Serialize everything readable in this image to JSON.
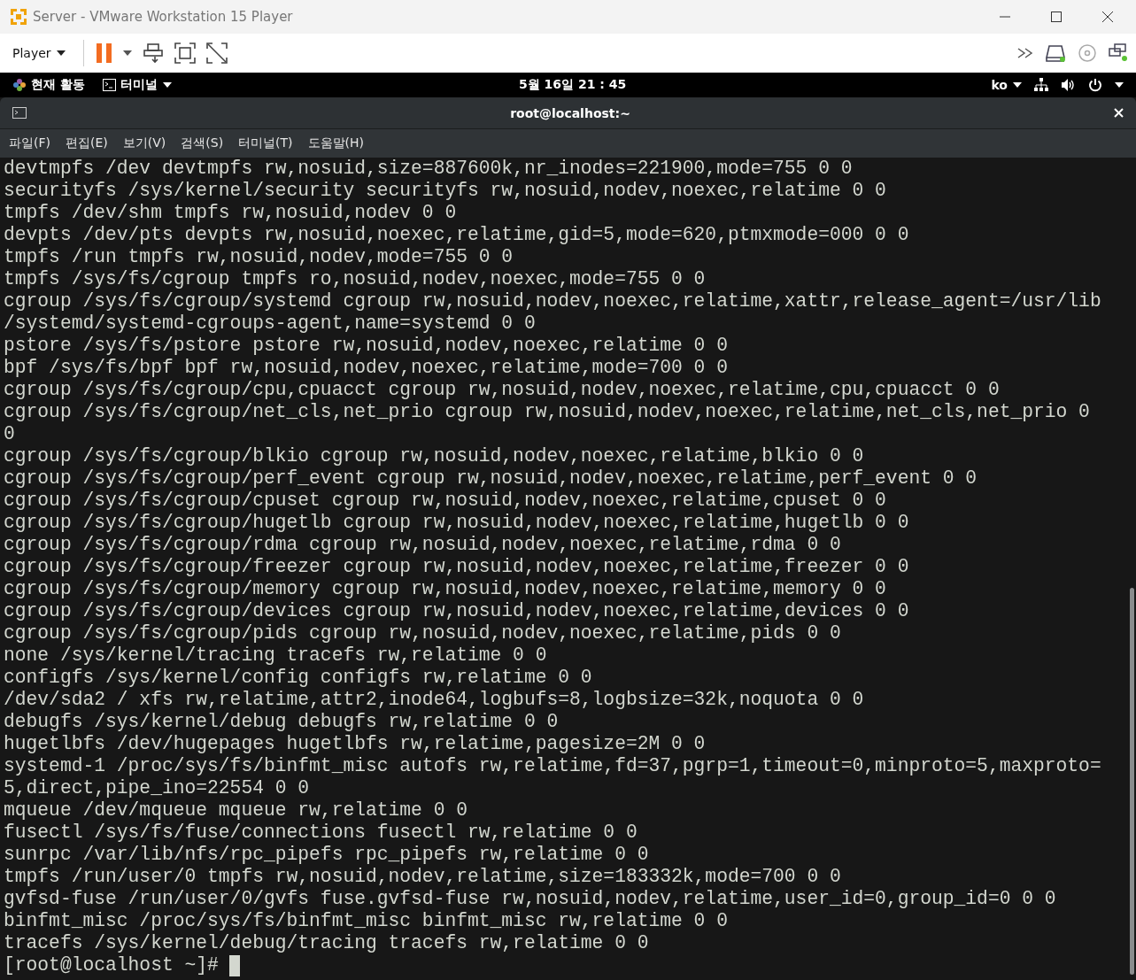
{
  "window": {
    "title": "Server - VMware Workstation 15 Player"
  },
  "toolbar": {
    "player_menu": "Player"
  },
  "top_bar": {
    "activities": "현재 활동",
    "app_menu": "터미널",
    "clock": "5월 16일  21 : 45",
    "input_method": "ko"
  },
  "terminal": {
    "title": "root@localhost:~",
    "menu": [
      "파일(F)",
      "편집(E)",
      "보기(V)",
      "검색(S)",
      "터미널(T)",
      "도움말(H)"
    ],
    "lines": [
      "devtmpfs /dev devtmpfs rw,nosuid,size=887600k,nr_inodes=221900,mode=755 0 0",
      "securityfs /sys/kernel/security securityfs rw,nosuid,nodev,noexec,relatime 0 0",
      "tmpfs /dev/shm tmpfs rw,nosuid,nodev 0 0",
      "devpts /dev/pts devpts rw,nosuid,noexec,relatime,gid=5,mode=620,ptmxmode=000 0 0",
      "tmpfs /run tmpfs rw,nosuid,nodev,mode=755 0 0",
      "tmpfs /sys/fs/cgroup tmpfs ro,nosuid,nodev,noexec,mode=755 0 0",
      "cgroup /sys/fs/cgroup/systemd cgroup rw,nosuid,nodev,noexec,relatime,xattr,release_agent=/usr/lib",
      "/systemd/systemd-cgroups-agent,name=systemd 0 0",
      "pstore /sys/fs/pstore pstore rw,nosuid,nodev,noexec,relatime 0 0",
      "bpf /sys/fs/bpf bpf rw,nosuid,nodev,noexec,relatime,mode=700 0 0",
      "cgroup /sys/fs/cgroup/cpu,cpuacct cgroup rw,nosuid,nodev,noexec,relatime,cpu,cpuacct 0 0",
      "cgroup /sys/fs/cgroup/net_cls,net_prio cgroup rw,nosuid,nodev,noexec,relatime,net_cls,net_prio 0",
      "0",
      "cgroup /sys/fs/cgroup/blkio cgroup rw,nosuid,nodev,noexec,relatime,blkio 0 0",
      "cgroup /sys/fs/cgroup/perf_event cgroup rw,nosuid,nodev,noexec,relatime,perf_event 0 0",
      "cgroup /sys/fs/cgroup/cpuset cgroup rw,nosuid,nodev,noexec,relatime,cpuset 0 0",
      "cgroup /sys/fs/cgroup/hugetlb cgroup rw,nosuid,nodev,noexec,relatime,hugetlb 0 0",
      "cgroup /sys/fs/cgroup/rdma cgroup rw,nosuid,nodev,noexec,relatime,rdma 0 0",
      "cgroup /sys/fs/cgroup/freezer cgroup rw,nosuid,nodev,noexec,relatime,freezer 0 0",
      "cgroup /sys/fs/cgroup/memory cgroup rw,nosuid,nodev,noexec,relatime,memory 0 0",
      "cgroup /sys/fs/cgroup/devices cgroup rw,nosuid,nodev,noexec,relatime,devices 0 0",
      "cgroup /sys/fs/cgroup/pids cgroup rw,nosuid,nodev,noexec,relatime,pids 0 0",
      "none /sys/kernel/tracing tracefs rw,relatime 0 0",
      "configfs /sys/kernel/config configfs rw,relatime 0 0",
      "/dev/sda2 / xfs rw,relatime,attr2,inode64,logbufs=8,logbsize=32k,noquota 0 0",
      "debugfs /sys/kernel/debug debugfs rw,relatime 0 0",
      "hugetlbfs /dev/hugepages hugetlbfs rw,relatime,pagesize=2M 0 0",
      "systemd-1 /proc/sys/fs/binfmt_misc autofs rw,relatime,fd=37,pgrp=1,timeout=0,minproto=5,maxproto=",
      "5,direct,pipe_ino=22554 0 0",
      "mqueue /dev/mqueue mqueue rw,relatime 0 0",
      "fusectl /sys/fs/fuse/connections fusectl rw,relatime 0 0",
      "sunrpc /var/lib/nfs/rpc_pipefs rpc_pipefs rw,relatime 0 0",
      "tmpfs /run/user/0 tmpfs rw,nosuid,nodev,relatime,size=183332k,mode=700 0 0",
      "gvfsd-fuse /run/user/0/gvfs fuse.gvfsd-fuse rw,nosuid,nodev,relatime,user_id=0,group_id=0 0 0",
      "binfmt_misc /proc/sys/fs/binfmt_misc binfmt_misc rw,relatime 0 0",
      "tracefs /sys/kernel/debug/tracing tracefs rw,relatime 0 0"
    ],
    "prompt": "[root@localhost ~]#"
  }
}
